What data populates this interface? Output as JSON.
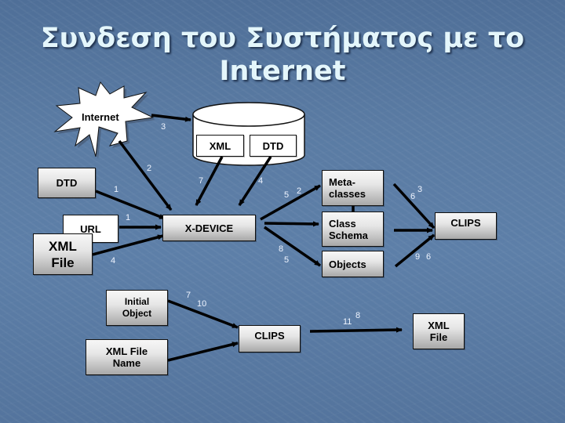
{
  "slide": {
    "title_line1": "Συνδεση του Συστήματος με το",
    "title_line2": "Internet"
  },
  "nodes": {
    "internet": "Internet",
    "db_xml": "XML",
    "db_dtd": "DTD",
    "dtd": "DTD",
    "url": "URL",
    "xml_file_left": "XML File",
    "xdevice": "X-DEVICE",
    "metaclasses": "Meta-classes",
    "class_schema": "Class Schema",
    "objects": "Objects",
    "clips_right": "CLIPS",
    "initial_object": "Initial Object",
    "xml_file_name": "XML File Name",
    "clips_bottom": "CLIPS",
    "xml_file_right": "XML File"
  },
  "edge_labels": {
    "internet_to_db": "3",
    "internet_to_xdevice": "2",
    "dtd_to_xdevice": "1",
    "url_to_xdevice": "1",
    "xmlfile_to_xdevice": "4",
    "dbxml_to_xdevice": "7",
    "dbdtd_to_xdevice": "4",
    "xdevice_to_meta_a": "5",
    "xdevice_to_meta_b": "2",
    "xdevice_to_objects_a": "8",
    "xdevice_to_objects_b": "5",
    "meta_to_clips_a": "6",
    "meta_to_clips_b": "3",
    "objects_to_clips_a": "9",
    "objects_to_clips_b": "6",
    "initobj_to_clips_a": "7",
    "initobj_to_clips_b": "10",
    "clips_to_xml_a": "11",
    "clips_to_xml_b": "8"
  }
}
